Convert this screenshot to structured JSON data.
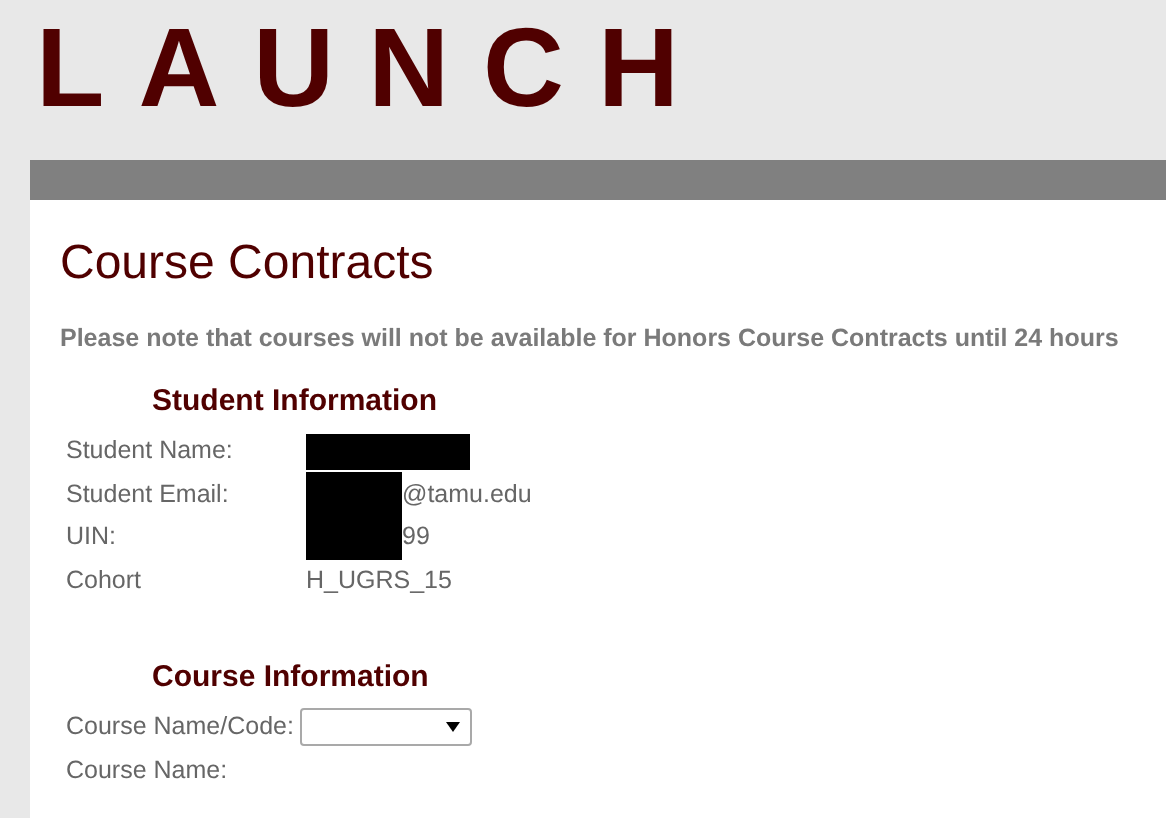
{
  "logo": "LAUNCH",
  "page_title": "Course Contracts",
  "notice": "Please note that courses will not be available for Honors Course Contracts until 24 hours",
  "sections": [
    {
      "heading": "Student Information",
      "rows": [
        {
          "kind": "text",
          "label": "Student Name:",
          "redacted": true
        },
        {
          "kind": "text",
          "label": "Student Email:",
          "redacted": true,
          "value": "@tamu.edu"
        },
        {
          "kind": "text",
          "label": "UIN:",
          "redacted": true,
          "value": "99"
        },
        {
          "kind": "text",
          "label": "Cohort",
          "redacted": false,
          "value": "H_UGRS_15"
        }
      ]
    },
    {
      "heading": "Course Information",
      "rows": [
        {
          "kind": "select",
          "label": "Course Name/Code:"
        },
        {
          "kind": "text",
          "label": "Course Name:",
          "redacted": false
        }
      ]
    }
  ]
}
